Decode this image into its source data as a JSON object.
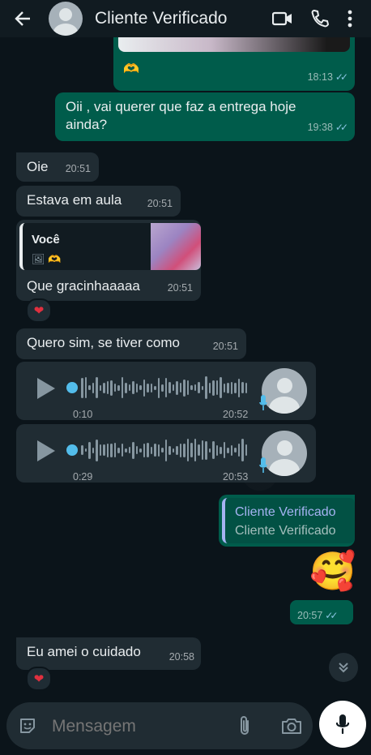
{
  "header": {
    "contact_name": "Cliente Verificado"
  },
  "messages": {
    "m0": {
      "reaction": "🫶",
      "time": "18:13"
    },
    "m1": {
      "line1": "Oii , vai querer que faz a entrega hoje",
      "line2": "ainda?",
      "time": "19:38"
    },
    "m2": {
      "text": "Oie",
      "time": "20:51"
    },
    "m3": {
      "text": "Estava em aula",
      "time": "20:51"
    },
    "m4": {
      "quote_author": "Você",
      "quote_icons": "🖼 🫶",
      "text": "Que gracinhaaaaa",
      "time": "20:51",
      "reaction": "❤"
    },
    "m5": {
      "text": "Quero sim, se tiver como",
      "time": "20:51"
    },
    "v1": {
      "duration": "0:10",
      "time": "20:52"
    },
    "v2": {
      "duration": "0:29",
      "time": "20:53"
    },
    "m6": {
      "quote_line1": "Cliente Verificado",
      "quote_line2": "Cliente Verificado"
    },
    "m7": {
      "emoji": "🥰"
    },
    "m8": {
      "time": "20:57"
    },
    "m9": {
      "text": "Eu amei o cuidado",
      "time": "20:58",
      "reaction": "❤"
    }
  },
  "composer": {
    "placeholder": "Mensagem"
  },
  "colors": {
    "header": "#111b21",
    "incoming": "#202c33",
    "outgoing": "#005c4b",
    "read_ticks": "#53bdeb",
    "background": "#0b141a"
  }
}
